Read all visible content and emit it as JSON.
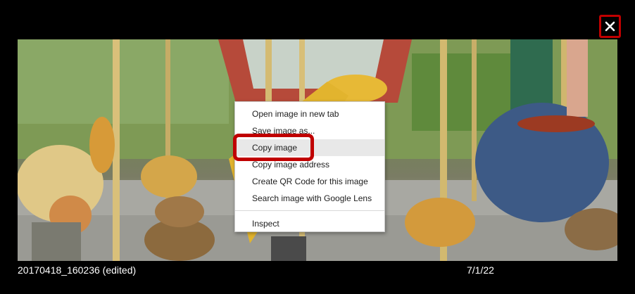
{
  "viewer": {
    "close_icon": "close-icon",
    "accent_color": "#c00000",
    "caption_filename": "20170418_160236 (edited)",
    "caption_date": "7/1/22"
  },
  "context_menu": {
    "items": [
      {
        "label": "Open image in new tab"
      },
      {
        "label": "Save image as..."
      },
      {
        "label": "Copy image"
      },
      {
        "label": "Copy image address"
      },
      {
        "label": "Create QR Code for this image"
      },
      {
        "label": "Search image with Google Lens"
      },
      {
        "label": "Inspect"
      }
    ],
    "hovered_item": "Copy image"
  }
}
